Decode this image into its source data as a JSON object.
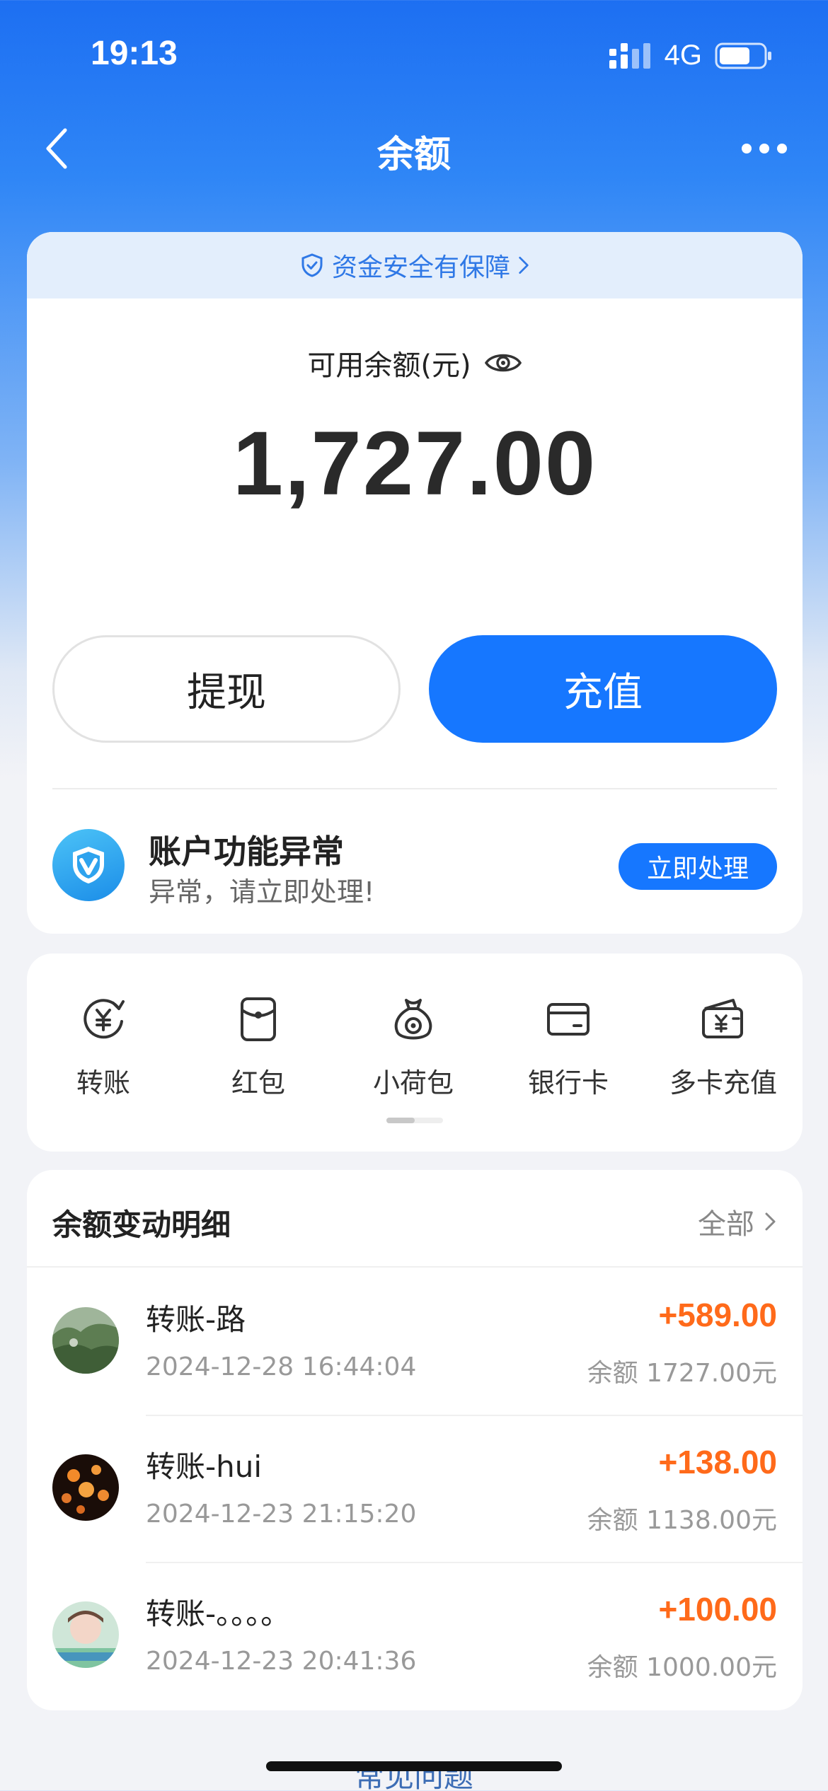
{
  "status_bar": {
    "time": "19:13",
    "network": "4G"
  },
  "nav": {
    "title": "余额"
  },
  "balance_card": {
    "safety_text": "资金安全有保障",
    "balance_label": "可用余额(元)",
    "balance_amount": "1,727.00",
    "withdraw_label": "提现",
    "recharge_label": "充值",
    "alert": {
      "title": "账户功能异常",
      "subtitle": "异常，请立即处理!",
      "button_label": "立即处理"
    }
  },
  "services": [
    {
      "label": "转账",
      "icon": "transfer-yen-icon"
    },
    {
      "label": "红包",
      "icon": "red-packet-icon"
    },
    {
      "label": "小荷包",
      "icon": "pouch-icon"
    },
    {
      "label": "银行卡",
      "icon": "bank-card-icon"
    },
    {
      "label": "多卡充值",
      "icon": "wallet-yen-icon"
    }
  ],
  "transactions": {
    "title": "余额变动明细",
    "filter_label": "全部",
    "items": [
      {
        "name": "转账-路",
        "time": "2024-12-28 16:44:04",
        "amount": "+589.00",
        "balance": "余额 1727.00元"
      },
      {
        "name": "转账-hui",
        "time": "2024-12-23 21:15:20",
        "amount": "+138.00",
        "balance": "余额 1138.00元"
      },
      {
        "name": "转账-。。。。",
        "time": "2024-12-23 20:41:36",
        "amount": "+100.00",
        "balance": "余额 1000.00元"
      }
    ]
  },
  "faq_label": "常见问题",
  "colors": {
    "primary": "#1677ff",
    "amount": "#ff6a1a",
    "banner_bg": "#e3eefc"
  }
}
